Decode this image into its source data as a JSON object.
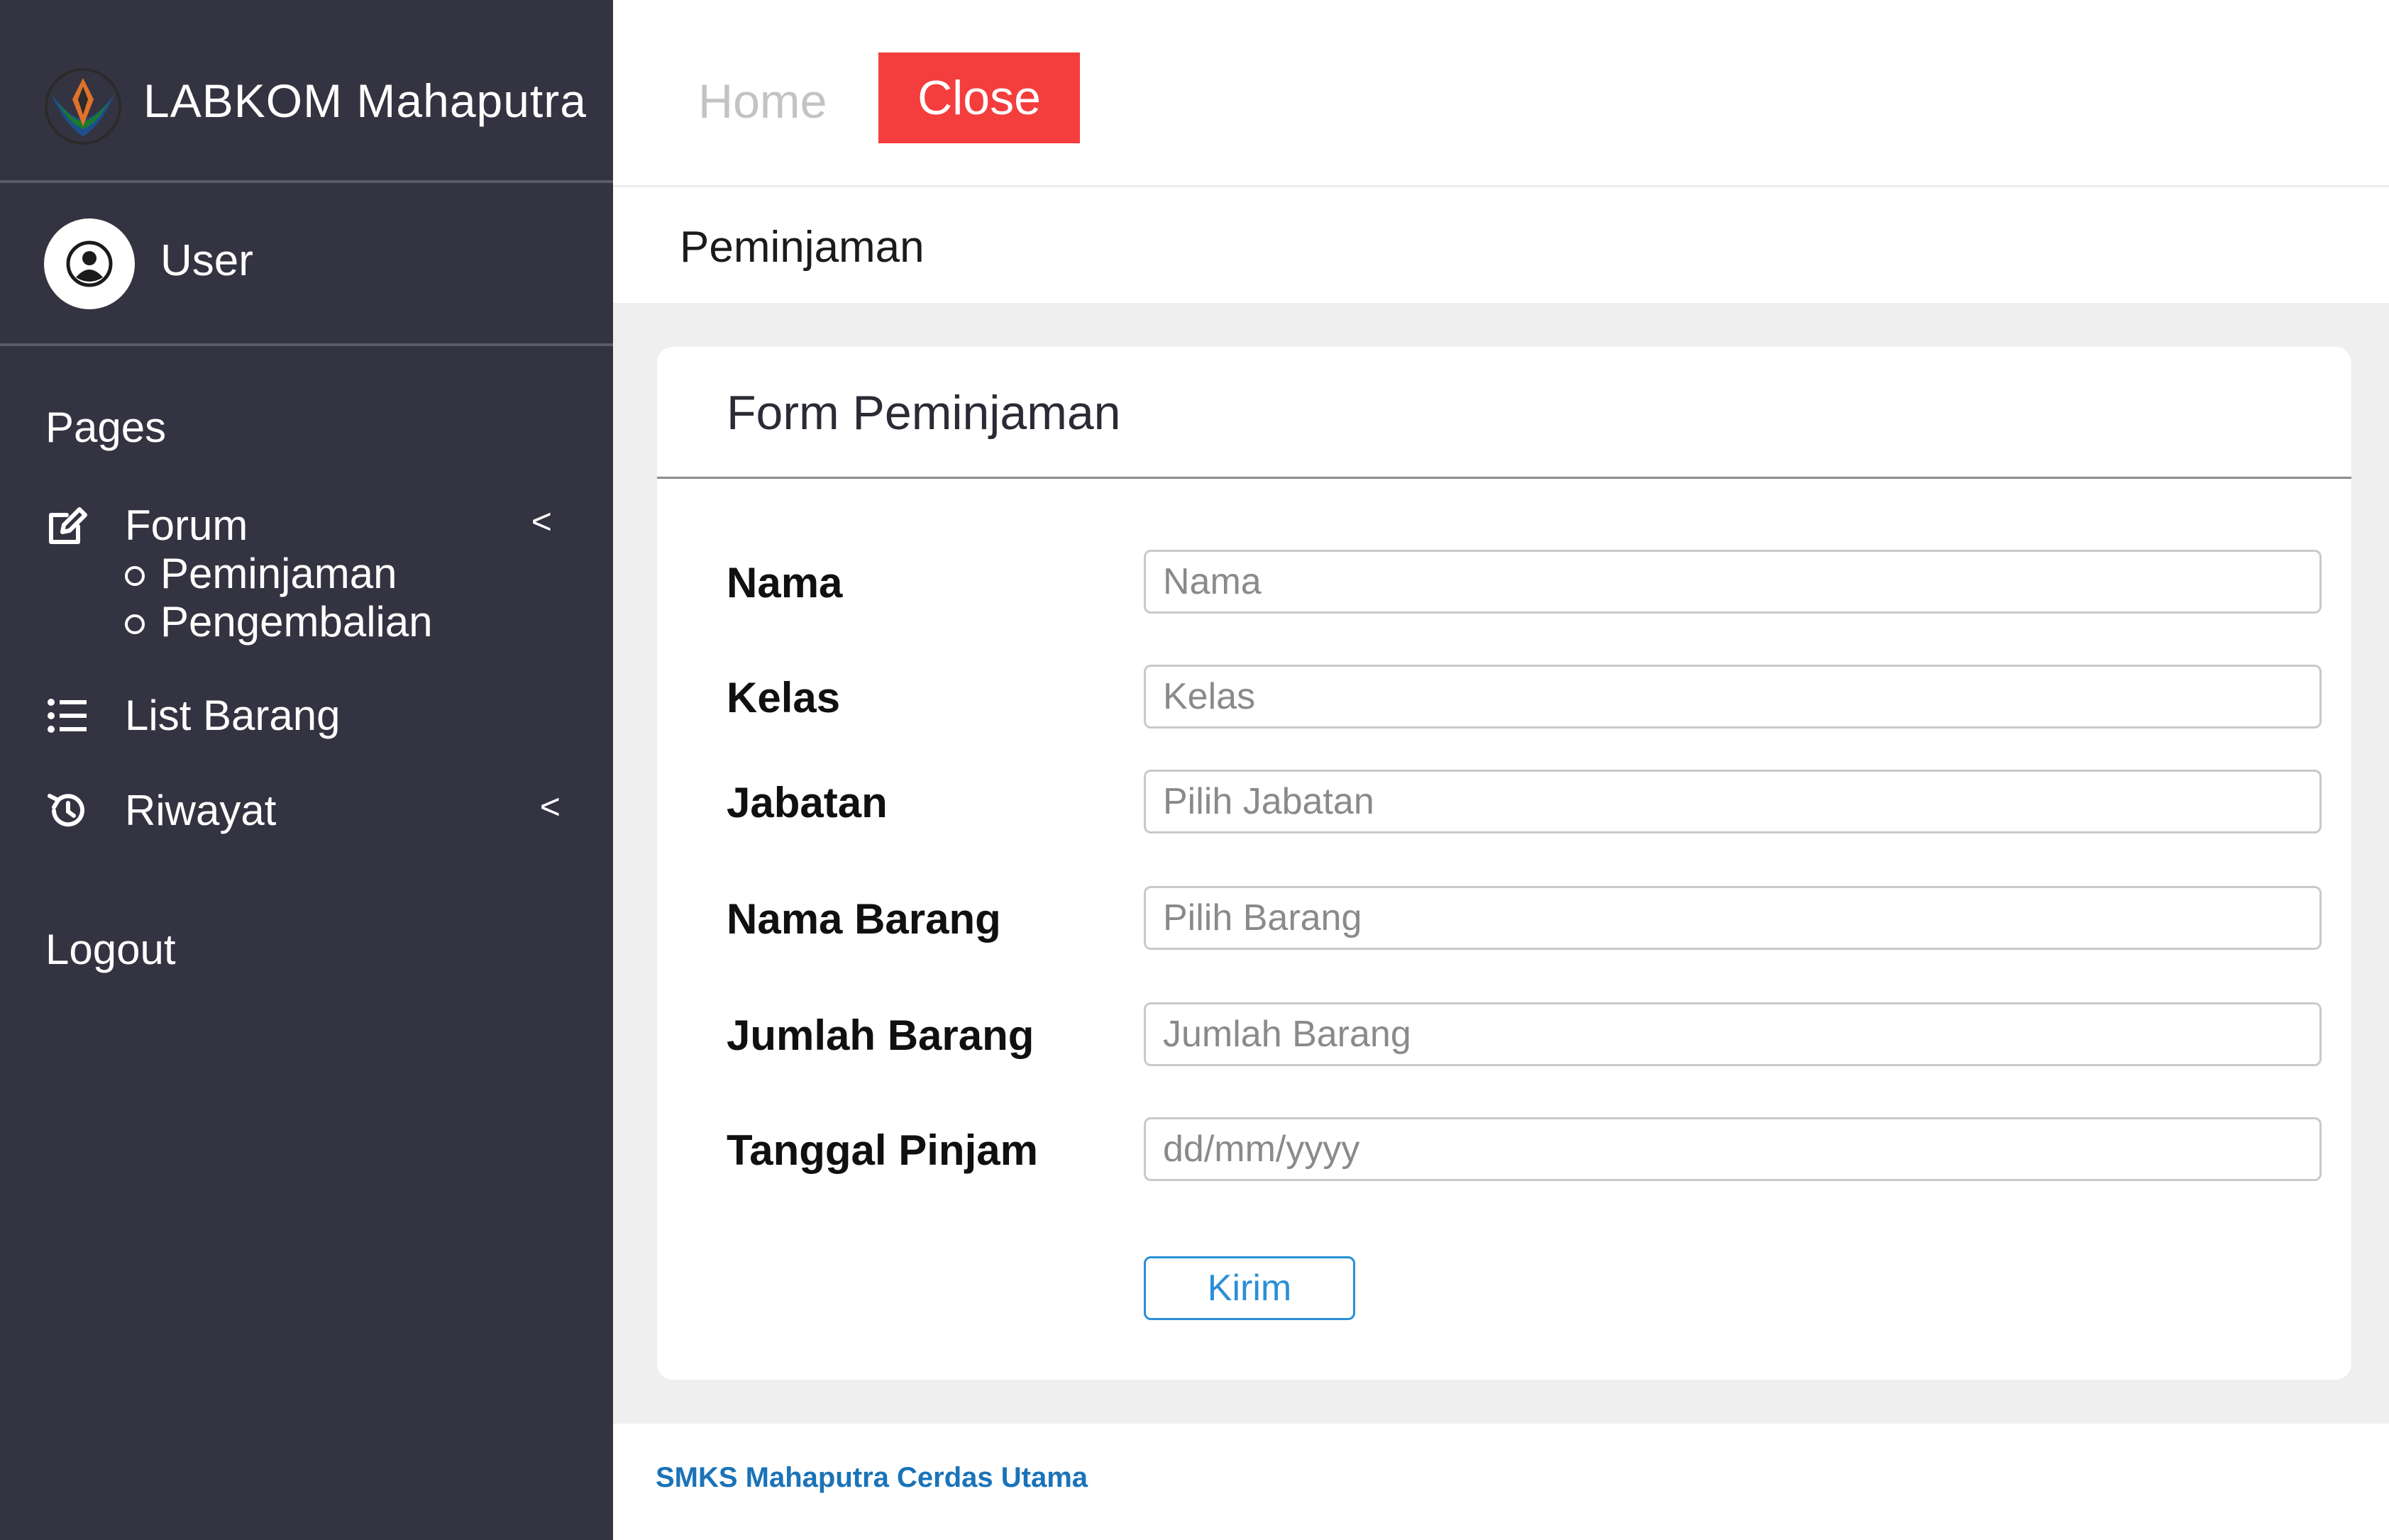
{
  "sidebar": {
    "brand_title": "LABKOM Mahaputra",
    "user_name": "User",
    "section_label": "Pages",
    "nav": {
      "forum": {
        "label": "Forum",
        "chevron": "<",
        "icon": "edit-icon"
      },
      "sub_items": [
        "Peminjaman",
        "Pengembalian"
      ],
      "list_barang": {
        "label": "List Barang",
        "icon": "list-icon"
      },
      "riwayat": {
        "label": "Riwayat",
        "chevron": "<",
        "icon": "history-icon"
      }
    },
    "logout_label": "Logout"
  },
  "topbar": {
    "home_label": "Home",
    "close_label": "Close"
  },
  "breadcrumb": {
    "title": "Peminjaman"
  },
  "form": {
    "title": "Form Peminjaman",
    "fields": [
      {
        "label": "Nama",
        "placeholder": "Nama"
      },
      {
        "label": "Kelas",
        "placeholder": "Kelas"
      },
      {
        "label": "Jabatan",
        "placeholder": "Pilih Jabatan"
      },
      {
        "label": "Nama Barang",
        "placeholder": "Pilih Barang"
      },
      {
        "label": "Jumlah Barang",
        "placeholder": "Jumlah Barang"
      },
      {
        "label": "Tanggal Pinjam",
        "placeholder": "dd/mm/yyyy"
      }
    ],
    "submit_label": "Kirim"
  },
  "footer": {
    "text": "SMKS Mahaputra Cerdas Utama"
  },
  "colors": {
    "sidebar_bg": "#343341",
    "close_button": "#f43d3d",
    "accent_blue": "#2a8fd6",
    "footer_text": "#1a73b8"
  }
}
